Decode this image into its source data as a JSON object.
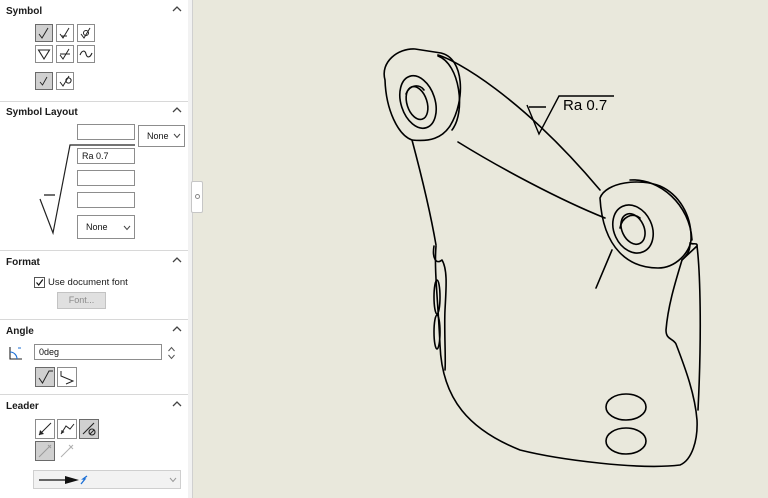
{
  "panel": {
    "symbol": {
      "title": "Symbol"
    },
    "symbol_layout": {
      "title": "Symbol Layout",
      "field_top": "",
      "dropdown_top": "None",
      "field_ra": "Ra 0.7",
      "field_3": "",
      "field_4": "",
      "dropdown_bottom": "None"
    },
    "format": {
      "title": "Format",
      "use_document_font_label": "Use document font",
      "use_document_font_checked": true,
      "font_button": "Font..."
    },
    "angle": {
      "title": "Angle",
      "value": "0deg"
    },
    "leader": {
      "title": "Leader"
    }
  },
  "drawing": {
    "annotation": "Ra 0.7"
  },
  "colors": {
    "canvas_bg": "#e9e8dc",
    "panel_bg": "#ffffff",
    "selected_button": "#d0d0d0",
    "arrow_accent": "#1b6fd6"
  }
}
